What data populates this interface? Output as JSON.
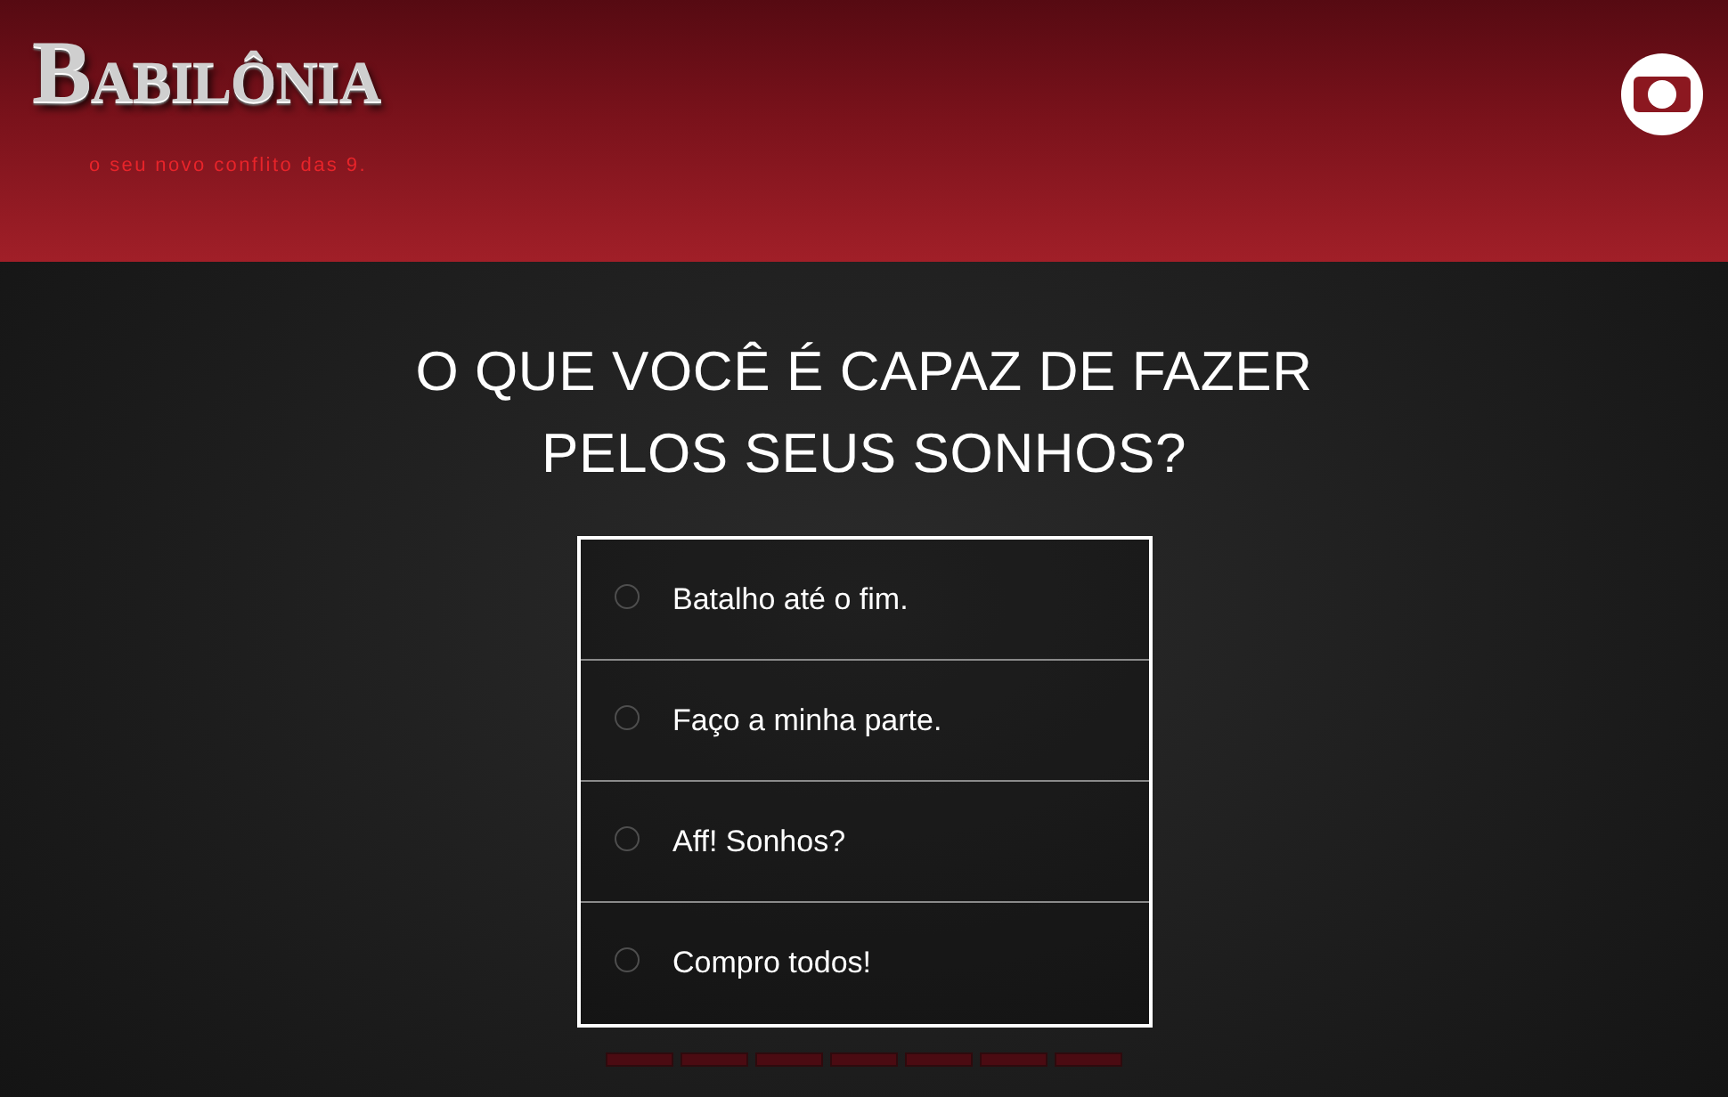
{
  "header": {
    "logo": "BABILÔNIA",
    "tagline": "o seu novo conflito das 9."
  },
  "quiz": {
    "question": "O QUE VOCÊ É CAPAZ DE FAZER PELOS SEUS SONHOS?",
    "options": [
      {
        "label": "Batalho até o fim.",
        "selected": false
      },
      {
        "label": "Faço a minha parte.",
        "selected": false
      },
      {
        "label": "Aff! Sonhos?",
        "selected": false
      },
      {
        "label": "Compro todos!",
        "selected": false
      }
    ]
  },
  "progress": {
    "steps": [
      {
        "done": false
      },
      {
        "done": false
      },
      {
        "done": false
      },
      {
        "done": false
      },
      {
        "done": false
      },
      {
        "done": false
      },
      {
        "done": false
      }
    ]
  }
}
